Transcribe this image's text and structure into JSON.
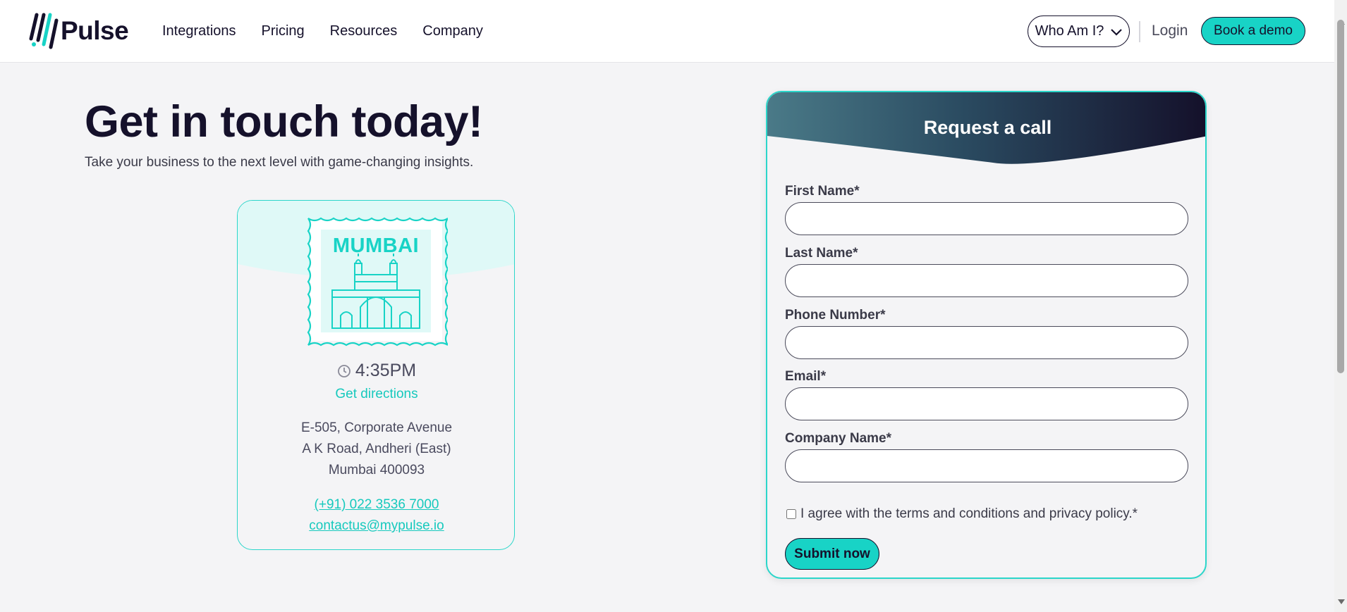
{
  "brand": {
    "name": "Pulse"
  },
  "nav": {
    "items": [
      {
        "label": "Integrations"
      },
      {
        "label": "Pricing"
      },
      {
        "label": "Resources"
      },
      {
        "label": "Company"
      }
    ],
    "who_label": "Who Am I?",
    "login_label": "Login",
    "demo_label": "Book a demo"
  },
  "hero": {
    "title": "Get in touch today!",
    "subtitle": "Take your business to the next level with game-changing insights."
  },
  "location": {
    "city": "MUMBAI",
    "time": "4:35PM",
    "directions_label": "Get directions",
    "address": [
      "E-505, Corporate Avenue",
      "A K Road, Andheri (East)",
      "Mumbai 400093"
    ],
    "phone": "(+91) 022 3536 7000",
    "email": "contactus@mypulse.io"
  },
  "form": {
    "title": "Request a call",
    "fields": [
      {
        "label": "First Name*",
        "value": ""
      },
      {
        "label": "Last Name*",
        "value": ""
      },
      {
        "label": "Phone Number*",
        "value": ""
      },
      {
        "label": "Email*",
        "value": ""
      },
      {
        "label": "Company Name*",
        "value": ""
      }
    ],
    "agree_label": "I agree with the terms and conditions and privacy policy.*",
    "submit_label": "Submit now"
  },
  "colors": {
    "accent": "#18d3c6",
    "dark": "#15112b",
    "background": "#f4f4f6"
  }
}
